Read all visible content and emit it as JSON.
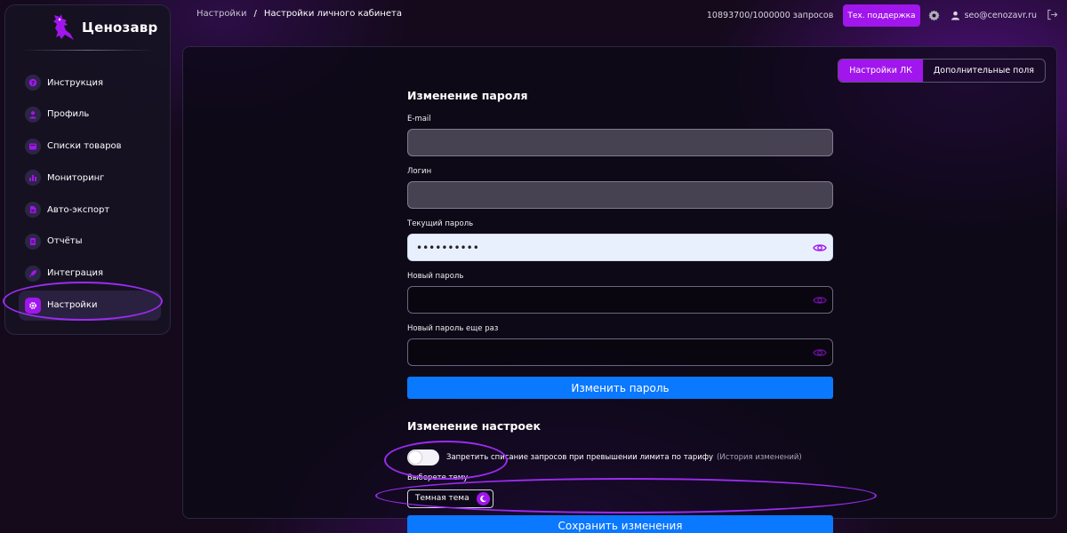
{
  "brand": {
    "name": "Ценозавр",
    "icon": "dinosaur-logo",
    "accent": "#a116ec"
  },
  "sidebar": {
    "items": [
      {
        "label": "Инструкция",
        "icon": "question-icon"
      },
      {
        "label": "Профиль",
        "icon": "user-icon"
      },
      {
        "label": "Списки товаров",
        "icon": "list-icon"
      },
      {
        "label": "Мониторинг",
        "icon": "chart-icon"
      },
      {
        "label": "Авто-экспорт",
        "icon": "export-icon"
      },
      {
        "label": "Отчёты",
        "icon": "report-icon"
      },
      {
        "label": "Интеграция",
        "icon": "rocket-icon"
      },
      {
        "label": "Настройки",
        "icon": "gear-icon",
        "active": true
      }
    ]
  },
  "breadcrumb": {
    "root": "Настройки",
    "separator": "/",
    "current": "Настройки личного кабинета"
  },
  "topbar": {
    "quota": "10893700/1000000 запросов",
    "support_label": "Тех. поддержка",
    "user_email": "seo@cenozavr.ru"
  },
  "tabs": [
    {
      "label": "Настройки ЛК",
      "active": true
    },
    {
      "label": "Дополнительные поля",
      "active": false
    }
  ],
  "password_form": {
    "title": "Изменение пароля",
    "email_label": "E-mail",
    "email_value": "",
    "login_label": "Логин",
    "login_value": "",
    "current_password_label": "Текущий пароль",
    "current_password_value": "••••••••••",
    "new_password_label": "Новый пароль",
    "new_password_value": "",
    "repeat_password_label": "Новый пароль еще раз",
    "repeat_password_value": "",
    "submit_label": "Изменить пароль"
  },
  "settings_form": {
    "title": "Изменение настроек",
    "toggle_label": "Запретить списание запросов при превышении лимита по тарифу",
    "toggle_on": false,
    "history_link": "(История изменений)",
    "theme_label": "Выберете тему",
    "theme_value": "Темная тема",
    "save_label": "Сохранить изменения"
  }
}
